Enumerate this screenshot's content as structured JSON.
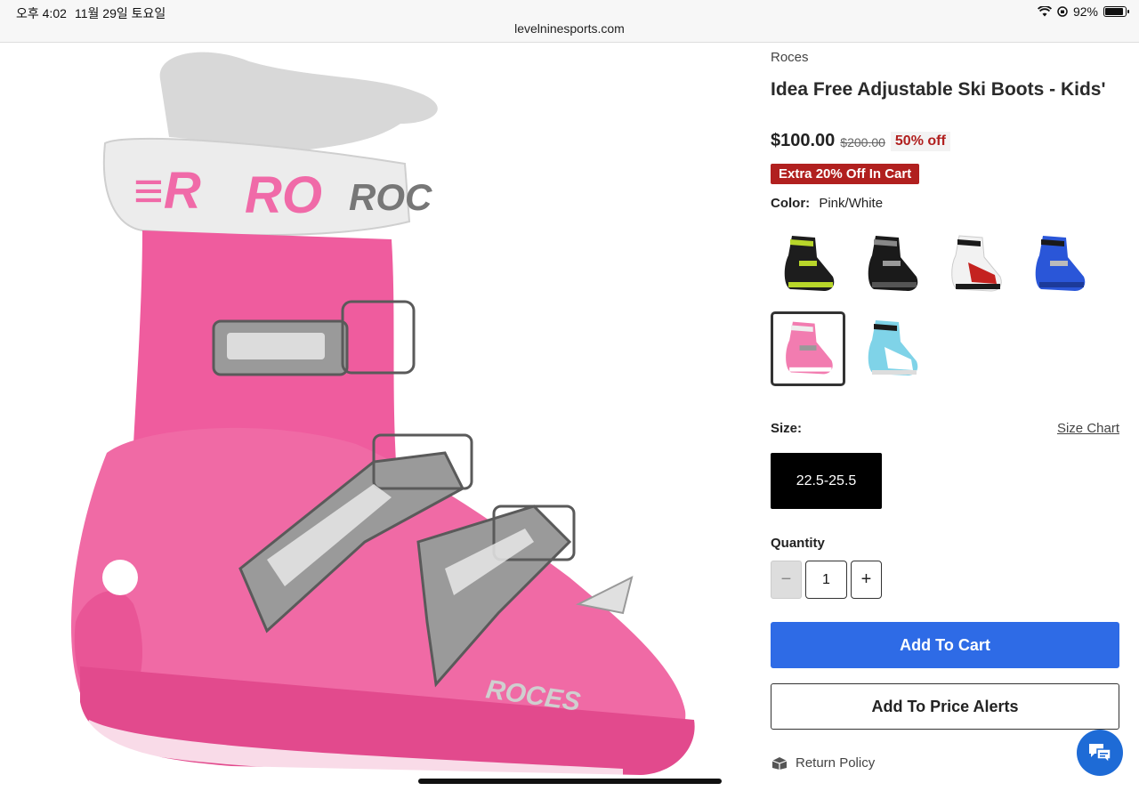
{
  "status_bar": {
    "time": "오후 4:02",
    "date": "11월 29일 토요일",
    "battery": "92%",
    "battery_level": 0.92
  },
  "browser": {
    "url": "levelninesports.com"
  },
  "product": {
    "brand": "Roces",
    "title": "Idea Free Adjustable Ski Boots - Kids'",
    "price": "$100.00",
    "original_price": "$200.00",
    "discount": "50% off",
    "promo": "Extra 20% Off In Cart",
    "color_label": "Color:",
    "color_value": "Pink/White",
    "colors": [
      {
        "name": "black-lime",
        "shell": "#1d1d1d",
        "accent": "#b8d62a"
      },
      {
        "name": "black-grey",
        "shell": "#1a1a1a",
        "accent": "#777777"
      },
      {
        "name": "white-red",
        "shell": "#f2f2f2",
        "accent": "#c4221f"
      },
      {
        "name": "blue",
        "shell": "#2a56d8",
        "accent": "#1c3a99"
      },
      {
        "name": "pink-white",
        "shell": "#f27cb0",
        "accent": "#ffffff",
        "selected": true
      },
      {
        "name": "light-blue-white",
        "shell": "#7fd3e8",
        "accent": "#ffffff"
      }
    ],
    "size_label": "Size:",
    "size_chart": "Size Chart",
    "size_option": "22.5-25.5",
    "quantity_label": "Quantity",
    "quantity_value": "1",
    "qty_minus": "−",
    "qty_plus": "+",
    "add_to_cart": "Add To Cart",
    "add_price_alert": "Add To Price Alerts",
    "return_policy": "Return Policy"
  },
  "colors": {
    "accent_blue": "#2e6be6",
    "sale_red": "#b1201f"
  }
}
